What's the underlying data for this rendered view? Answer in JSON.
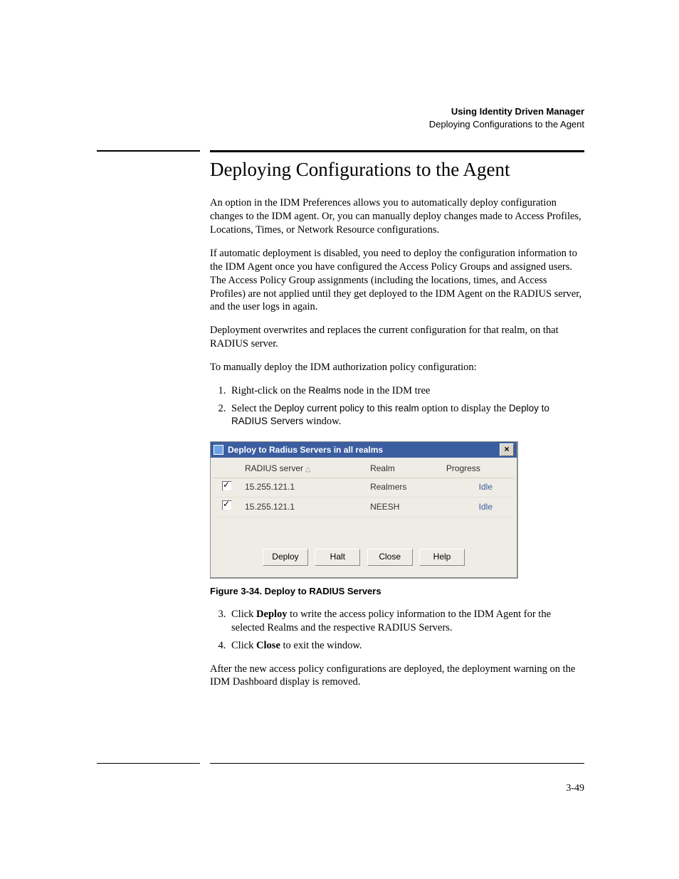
{
  "header": {
    "chapter": "Using Identity Driven Manager",
    "section": "Deploying Configurations to the Agent"
  },
  "title": "Deploying Configurations to the Agent",
  "paragraphs": {
    "p1": "An option in the IDM Preferences allows you to automatically deploy configuration changes to the IDM agent. Or, you can manually deploy changes made to Access Profiles, Locations, Times, or Network Resource configurations.",
    "p2": "If automatic deployment is disabled, you need to deploy the configuration information to the IDM Agent once you have configured the Access Policy Groups and assigned users. The Access Policy Group assignments (including the locations, times, and Access Profiles) are not applied until they get deployed to the IDM Agent on the RADIUS server, and the user logs in again.",
    "p3": "Deployment overwrites and replaces the current configuration for that realm, on that RADIUS server.",
    "p4": "To manually deploy the IDM authorization policy configuration:",
    "p5": "After the new access policy configurations are deployed, the deployment warning on the IDM Dashboard display is removed."
  },
  "steps12": {
    "s1_pre": "Right-click on the ",
    "s1_ui": "Realms",
    "s1_post": " node in the IDM tree",
    "s2_pre": "Select the ",
    "s2_ui1": "Deploy current policy to this realm",
    "s2_mid": " option to display the ",
    "s2_ui2": "Deploy to RADIUS Servers",
    "s2_post": " window."
  },
  "dialog": {
    "title": "Deploy to Radius Servers in all realms",
    "columns": {
      "c1": "RADIUS server",
      "c2": "Realm",
      "c3": "Progress"
    },
    "rows": [
      {
        "checked": true,
        "server": "15.255.121.1",
        "realm": "Realmers",
        "progress": "Idle"
      },
      {
        "checked": true,
        "server": "15.255.121.1",
        "realm": "NEESH",
        "progress": "Idle"
      }
    ],
    "buttons": {
      "deploy": "Deploy",
      "halt": "Halt",
      "close": "Close",
      "help": "Help"
    }
  },
  "figcaption": "Figure 3-34. Deploy to RADIUS Servers",
  "steps34": {
    "s3_pre": "Click ",
    "s3_bold": "Deploy",
    "s3_post": " to write the access policy information to the IDM Agent for the selected Realms and the respective RADIUS Servers.",
    "s4_pre": "Click ",
    "s4_bold": "Close",
    "s4_post": " to exit the window."
  },
  "page_number": "3-49"
}
